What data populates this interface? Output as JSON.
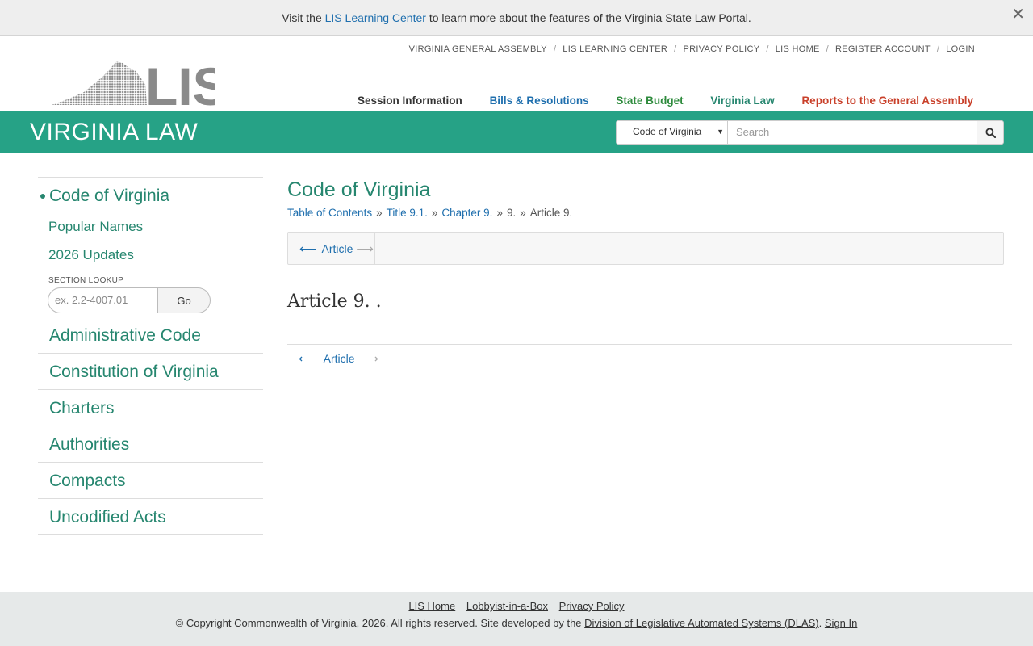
{
  "banner": {
    "prefix": "Visit the",
    "link": "LIS Learning Center",
    "suffix": "to learn more about the features of the Virginia State Law Portal.",
    "close": "✕"
  },
  "utility_nav": [
    "VIRGINIA GENERAL ASSEMBLY",
    "LIS LEARNING CENTER",
    "PRIVACY POLICY",
    "LIS HOME",
    "REGISTER ACCOUNT",
    "LOGIN"
  ],
  "logo_text": "LIS",
  "main_nav": [
    {
      "label": "Session Information",
      "color": "#333333"
    },
    {
      "label": "Bills & Resolutions",
      "color": "#1f6fae"
    },
    {
      "label": "State Budget",
      "color": "#2e8b3d"
    },
    {
      "label": "Virginia Law",
      "color": "#26866f"
    },
    {
      "label": "Reports to the General Assembly",
      "color": "#c9402a"
    }
  ],
  "section_title": "VIRGINIA LAW",
  "search": {
    "scope": "Code of Virginia",
    "placeholder": "Search"
  },
  "sidebar": {
    "active": "Code of Virginia",
    "sub_items": [
      "Popular Names",
      "2026 Updates"
    ],
    "lookup_label": "SECTION LOOKUP",
    "lookup_placeholder": "ex. 2.2-4007.01",
    "lookup_button": "Go",
    "items": [
      "Administrative Code",
      "Constitution of Virginia",
      "Charters",
      "Authorities",
      "Compacts",
      "Uncodified Acts"
    ]
  },
  "main": {
    "title": "Code of Virginia",
    "breadcrumbs": [
      "Table of Contents",
      "Title 9.1.",
      "Chapter 9."
    ],
    "crumb_tail_1": "9.",
    "crumb_tail_2": "Article 9.",
    "nav_label": "Article",
    "article_heading": "Article 9. ."
  },
  "footer": {
    "links": [
      "LIS Home",
      "Lobbyist-in-a-Box",
      "Privacy Policy"
    ],
    "copy_prefix": "© Copyright Commonwealth of Virginia, 2026. All rights reserved. Site developed by the",
    "dlas": "Division of Legislative Automated Systems (DLAS)",
    "sign_in": "Sign In"
  },
  "colors": {
    "brand_green": "#26a286",
    "link_green": "#26866f",
    "link_blue": "#1f6fae"
  }
}
